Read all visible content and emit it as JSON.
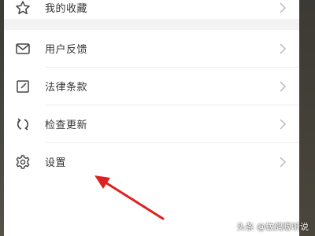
{
  "menu": {
    "favorites": {
      "label": "我的收藏",
      "icon": "star-icon"
    },
    "feedback": {
      "label": "用户反馈",
      "icon": "mail-icon"
    },
    "legal": {
      "label": "法律条款",
      "icon": "edit-box-icon"
    },
    "update": {
      "label": "检查更新",
      "icon": "refresh-icon"
    },
    "settings": {
      "label": "设置",
      "icon": "gear-icon"
    }
  },
  "watermark": "头条 @蚊鸽眼听说",
  "colors": {
    "arrow": "#e02020",
    "icon": "#444444",
    "chevron": "#bbbbbb"
  }
}
